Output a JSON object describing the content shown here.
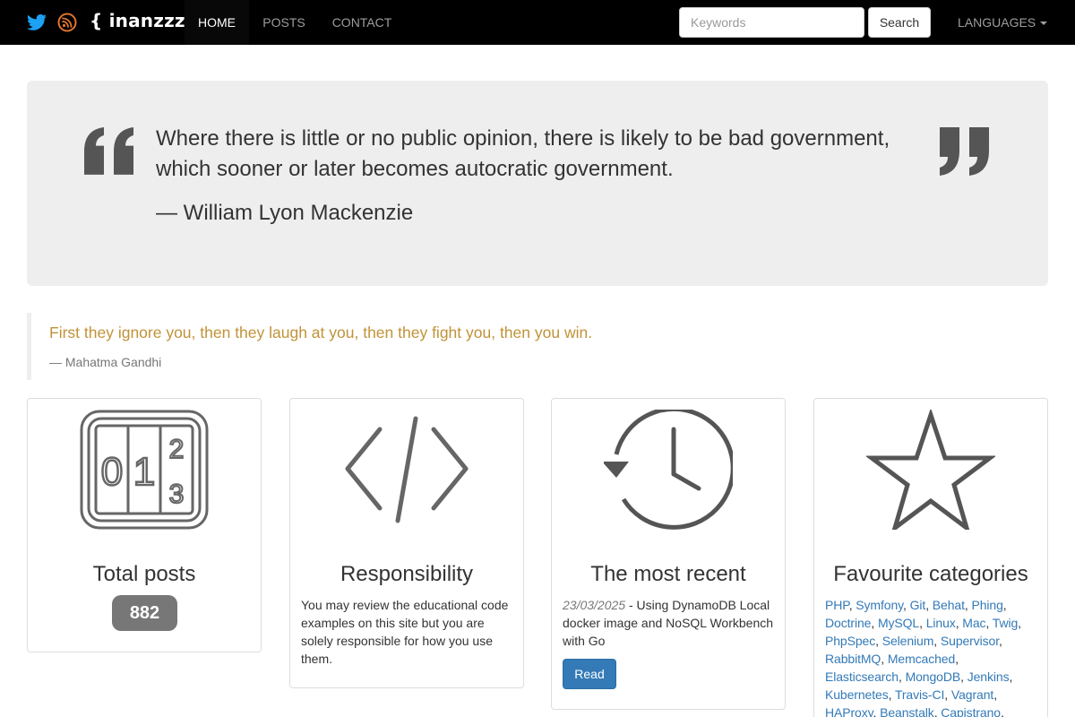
{
  "navbar": {
    "icons": [
      "twitter-icon",
      "rss-icon"
    ],
    "brand": "{ inanzzz }",
    "links": [
      "HOME",
      "POSTS",
      "CONTACT"
    ],
    "active": "HOME",
    "search": {
      "placeholder": "Keywords",
      "value": "",
      "button": "Search"
    },
    "languages": "LANGUAGES"
  },
  "jumbotron": {
    "quote": "Where there is little or no public opinion, there is likely to be bad government, which sooner or later becomes autocratic government.",
    "author": "— William Lyon Mackenzie"
  },
  "blockquote": {
    "text": "First they ignore you, then they laugh at you, then they fight you, then you win.",
    "author": "— Mahatma Gandhi"
  },
  "cards": {
    "total": {
      "icon": "counter-icon",
      "title": "Total posts",
      "count": "882"
    },
    "responsibility": {
      "icon": "code-icon",
      "title": "Responsibility",
      "text": "You may review the educational code examples on this site but you are solely responsible for how you use them."
    },
    "recent": {
      "icon": "history-icon",
      "title": "The most recent",
      "date": "23/03/2025",
      "text": " - Using DynamoDB Local docker image and NoSQL Workbench with Go",
      "button": "Read"
    },
    "favourites": {
      "icon": "star-icon",
      "title": "Favourite categories",
      "categories": [
        "PHP",
        "Symfony",
        "Git",
        "Behat",
        "Phing",
        "Doctrine",
        "MySQL",
        "Linux",
        "Mac",
        "Twig",
        "PhpSpec",
        "Selenium",
        "Supervisor",
        "RabbitMQ",
        "Memcached",
        "Elasticsearch",
        "MongoDB",
        "Jenkins",
        "Kubernetes",
        "Travis-CI",
        "Vagrant",
        "HAProxy",
        "Beanstalk",
        "Capistrano"
      ]
    }
  },
  "colors": {
    "navbar": "#000000",
    "link": "#337ab7",
    "quote_accent": "#c09338",
    "badge": "#777777",
    "primary_button": "#337ab7"
  }
}
